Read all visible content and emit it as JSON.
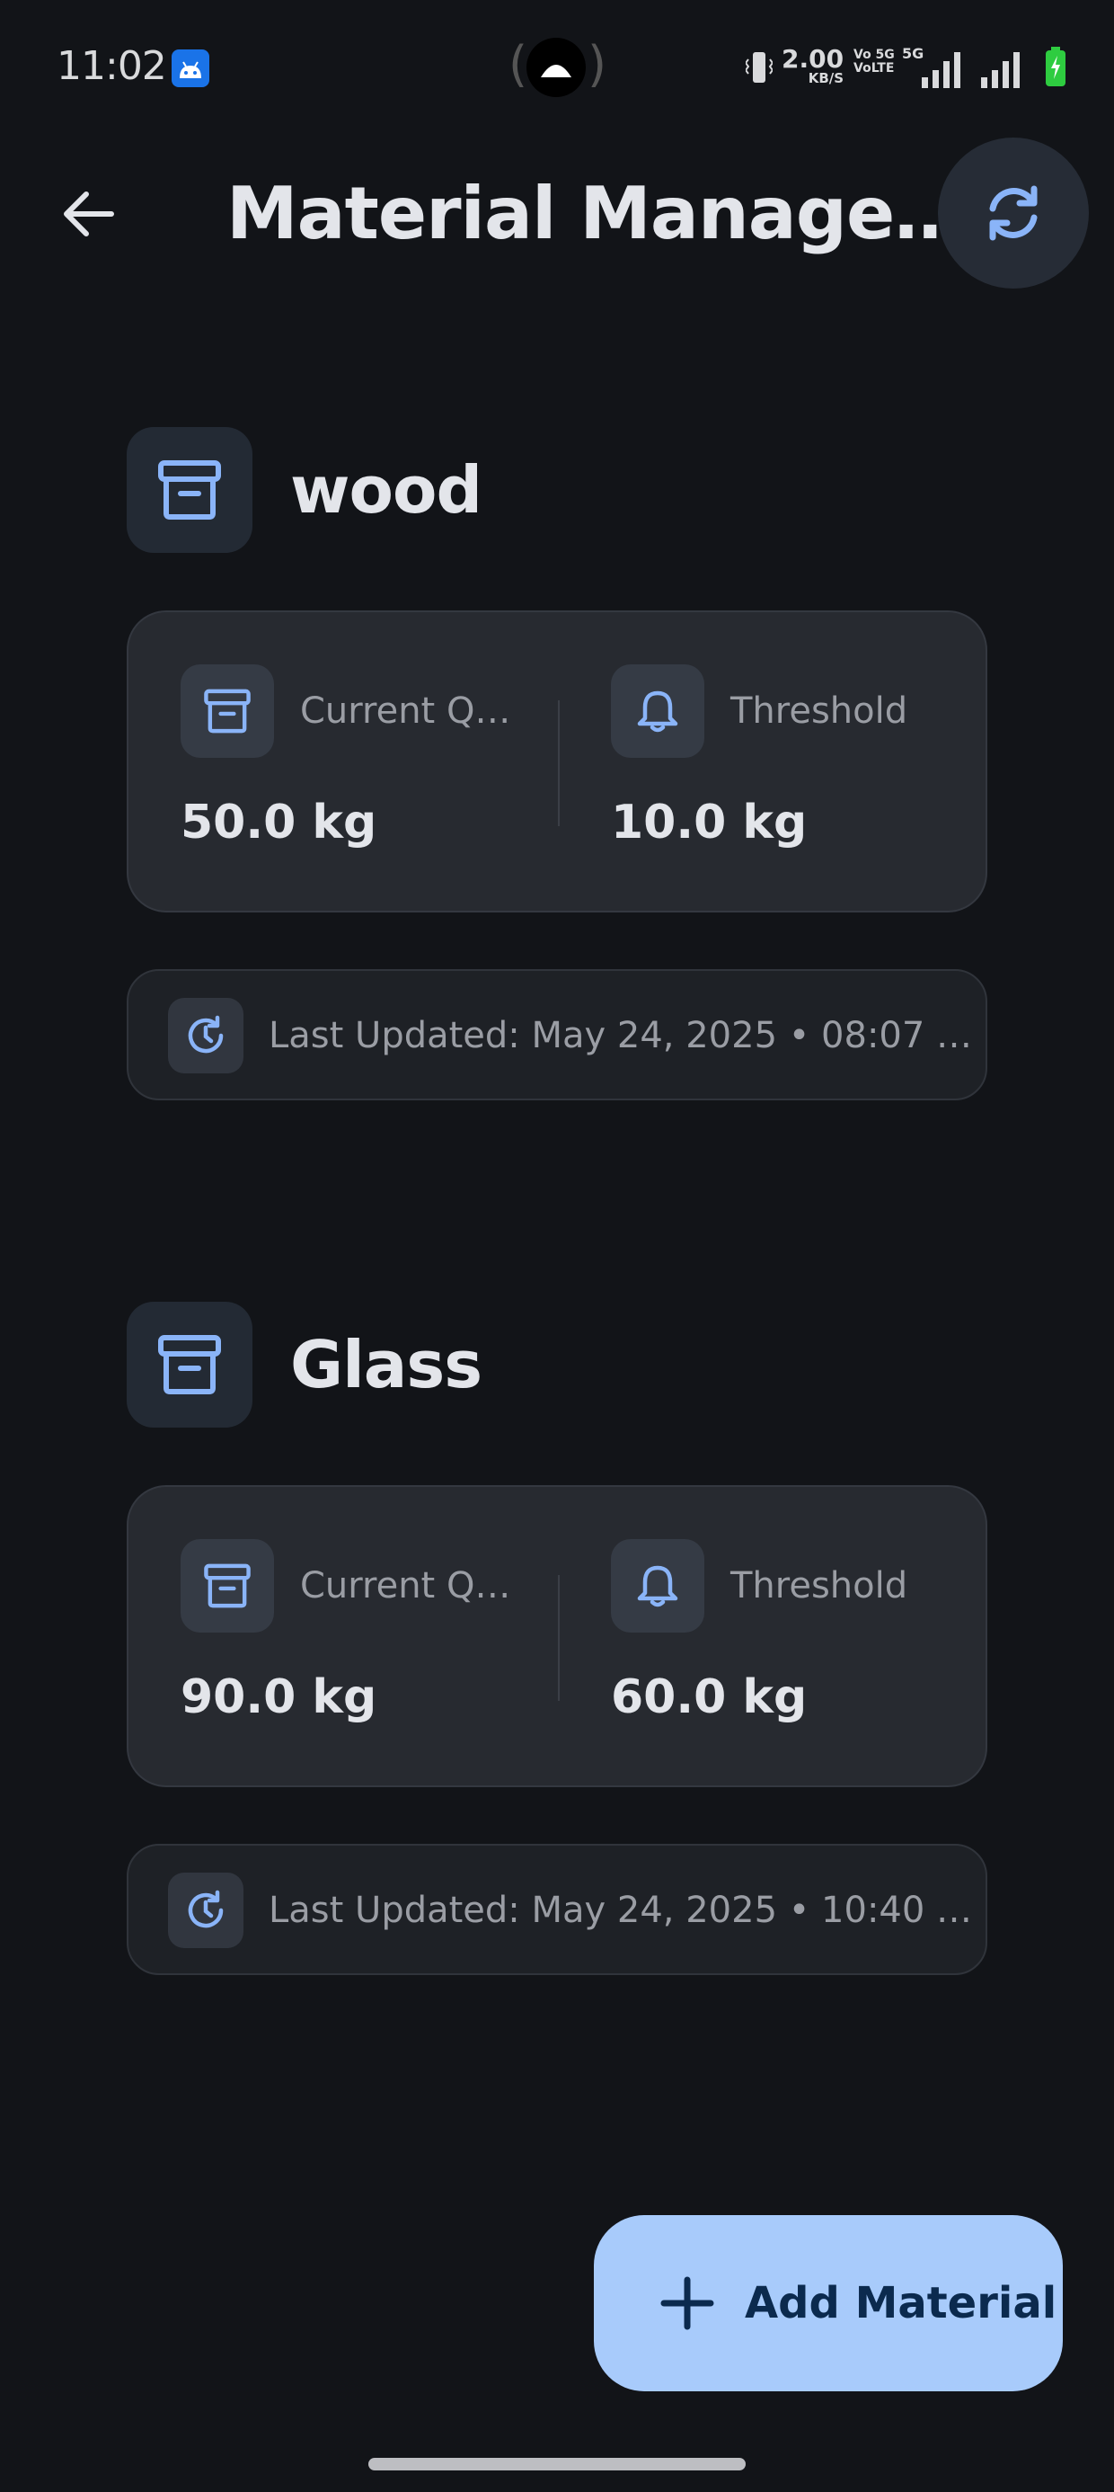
{
  "status_bar": {
    "time": "11:02",
    "net_speed_value": "2.00",
    "net_speed_unit": "KB/S",
    "volte_line1": "Vo 5G",
    "volte_line2": "VoLTE",
    "network_type": "5G",
    "icons": [
      "android-app-icon",
      "hotspot-icon",
      "vibrate-icon",
      "signal-icon",
      "signal-icon",
      "battery-charging-icon"
    ]
  },
  "app_bar": {
    "title": "Material Manage…",
    "back_icon": "arrow-back-icon",
    "refresh_icon": "refresh-icon"
  },
  "materials": [
    {
      "name": "wood",
      "current_label": "Current Q…",
      "current_value": "50.0 kg",
      "threshold_label": "Threshold",
      "threshold_value": "10.0 kg",
      "last_updated": "Last Updated: May 24, 2025 • 08:07 …"
    },
    {
      "name": "Glass",
      "current_label": "Current Q…",
      "current_value": "90.0 kg",
      "threshold_label": "Threshold",
      "threshold_value": "60.0 kg",
      "last_updated": "Last Updated: May 24, 2025 • 10:40 …"
    }
  ],
  "fab": {
    "label": "Add Material",
    "icon": "plus-icon"
  },
  "colors": {
    "background": "#121418",
    "card": "#272a30",
    "accent": "#8ab4f8",
    "fab_bg": "#a8cbfb",
    "fab_text": "#0b2a4e"
  }
}
